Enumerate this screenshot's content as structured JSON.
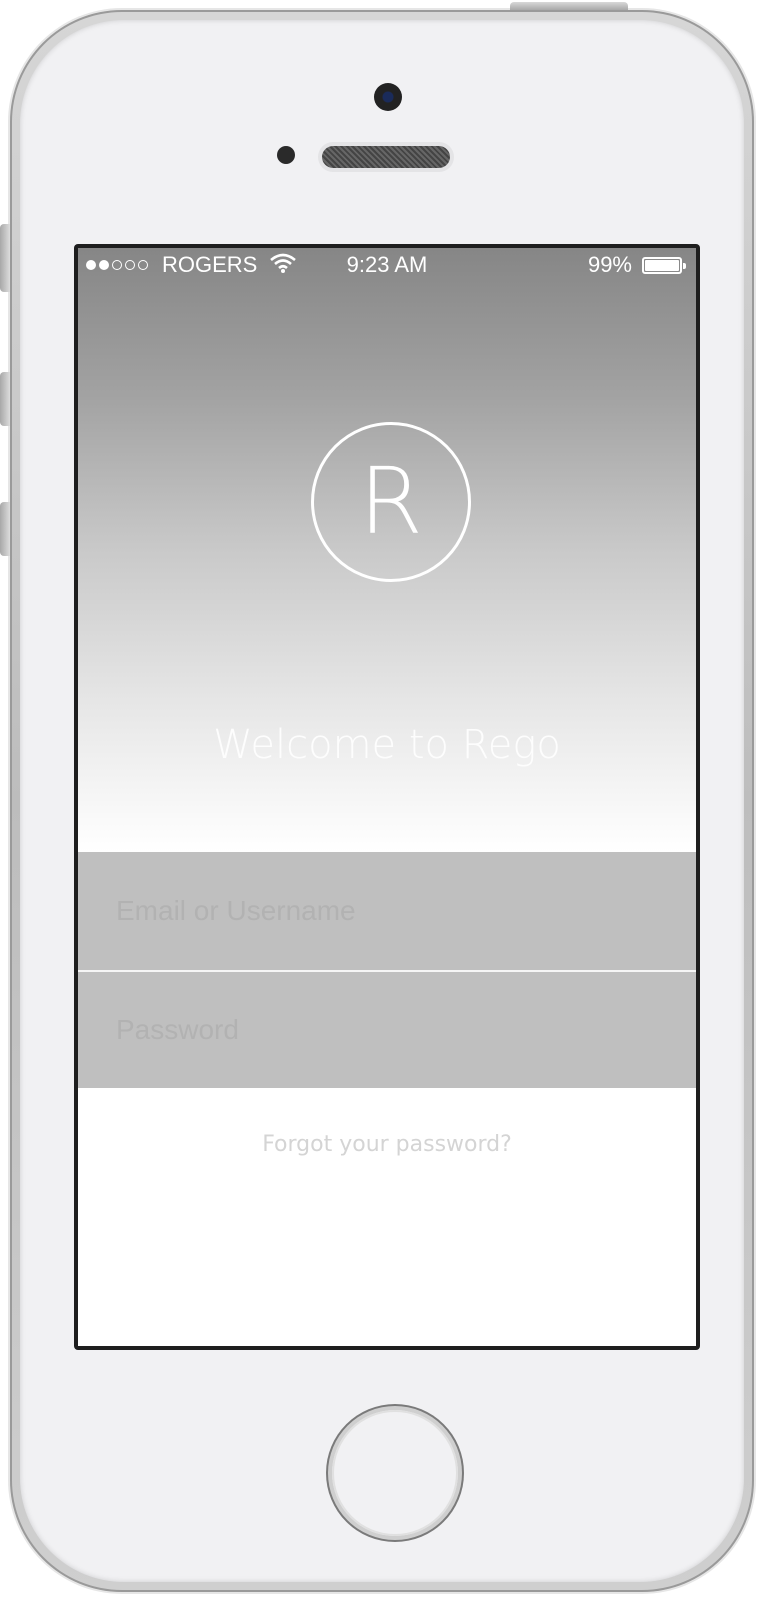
{
  "status_bar": {
    "signal_bars_filled": 2,
    "signal_bars_total": 5,
    "carrier": "ROGERS",
    "wifi_icon": "wifi-icon",
    "time": "9:23 AM",
    "battery_percent": "99%",
    "battery_level": 0.99
  },
  "hero": {
    "logo_letter": "R",
    "welcome_text": "Welcome to Rego"
  },
  "login_form": {
    "email_placeholder": "Email or Username",
    "email_value": "",
    "password_placeholder": "Password",
    "password_value": "",
    "forgot_link": "Forgot your password?"
  },
  "colors": {
    "gradient_top": "#868686",
    "gradient_bottom": "#ffffff",
    "field_background": "#bfbfbf",
    "text_white": "#ffffff"
  }
}
